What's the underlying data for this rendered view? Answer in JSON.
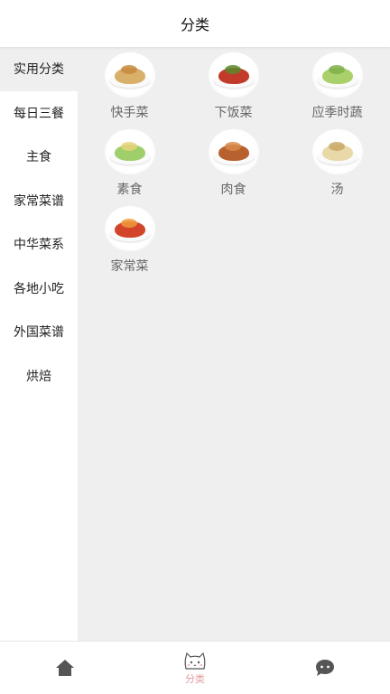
{
  "header": {
    "title": "分类"
  },
  "sidebar": {
    "items": [
      {
        "label": "实用分类",
        "active": true
      },
      {
        "label": "每日三餐"
      },
      {
        "label": "主食"
      },
      {
        "label": "家常菜谱"
      },
      {
        "label": "中华菜系"
      },
      {
        "label": "各地小吃"
      },
      {
        "label": "外国菜谱"
      },
      {
        "label": "烘焙"
      }
    ]
  },
  "categories": [
    {
      "label": "快手菜",
      "icon": "quick-dish-icon",
      "food_color": "#d9b06a",
      "accent": "#c7893e"
    },
    {
      "label": "下饭菜",
      "icon": "rice-dish-icon",
      "food_color": "#c23a2a",
      "accent": "#5a8a2a"
    },
    {
      "label": "应季时蔬",
      "icon": "vegetable-icon",
      "food_color": "#a9d06b",
      "accent": "#7fb04a"
    },
    {
      "label": "素食",
      "icon": "vegetarian-icon",
      "food_color": "#9fcf6a",
      "accent": "#e8d27a"
    },
    {
      "label": "肉食",
      "icon": "meat-icon",
      "food_color": "#b8612e",
      "accent": "#d88a4a"
    },
    {
      "label": "汤",
      "icon": "soup-icon",
      "food_color": "#e9d8a8",
      "accent": "#c9a866"
    },
    {
      "label": "家常菜",
      "icon": "home-dish-icon",
      "food_color": "#d2452a",
      "accent": "#f09a3a"
    }
  ],
  "tabbar": {
    "tabs": [
      {
        "name": "home-icon",
        "label": ""
      },
      {
        "name": "category-cat-icon",
        "label": "分类",
        "active": true
      },
      {
        "name": "chat-icon",
        "label": ""
      }
    ],
    "active_color": "#e29aa0"
  }
}
